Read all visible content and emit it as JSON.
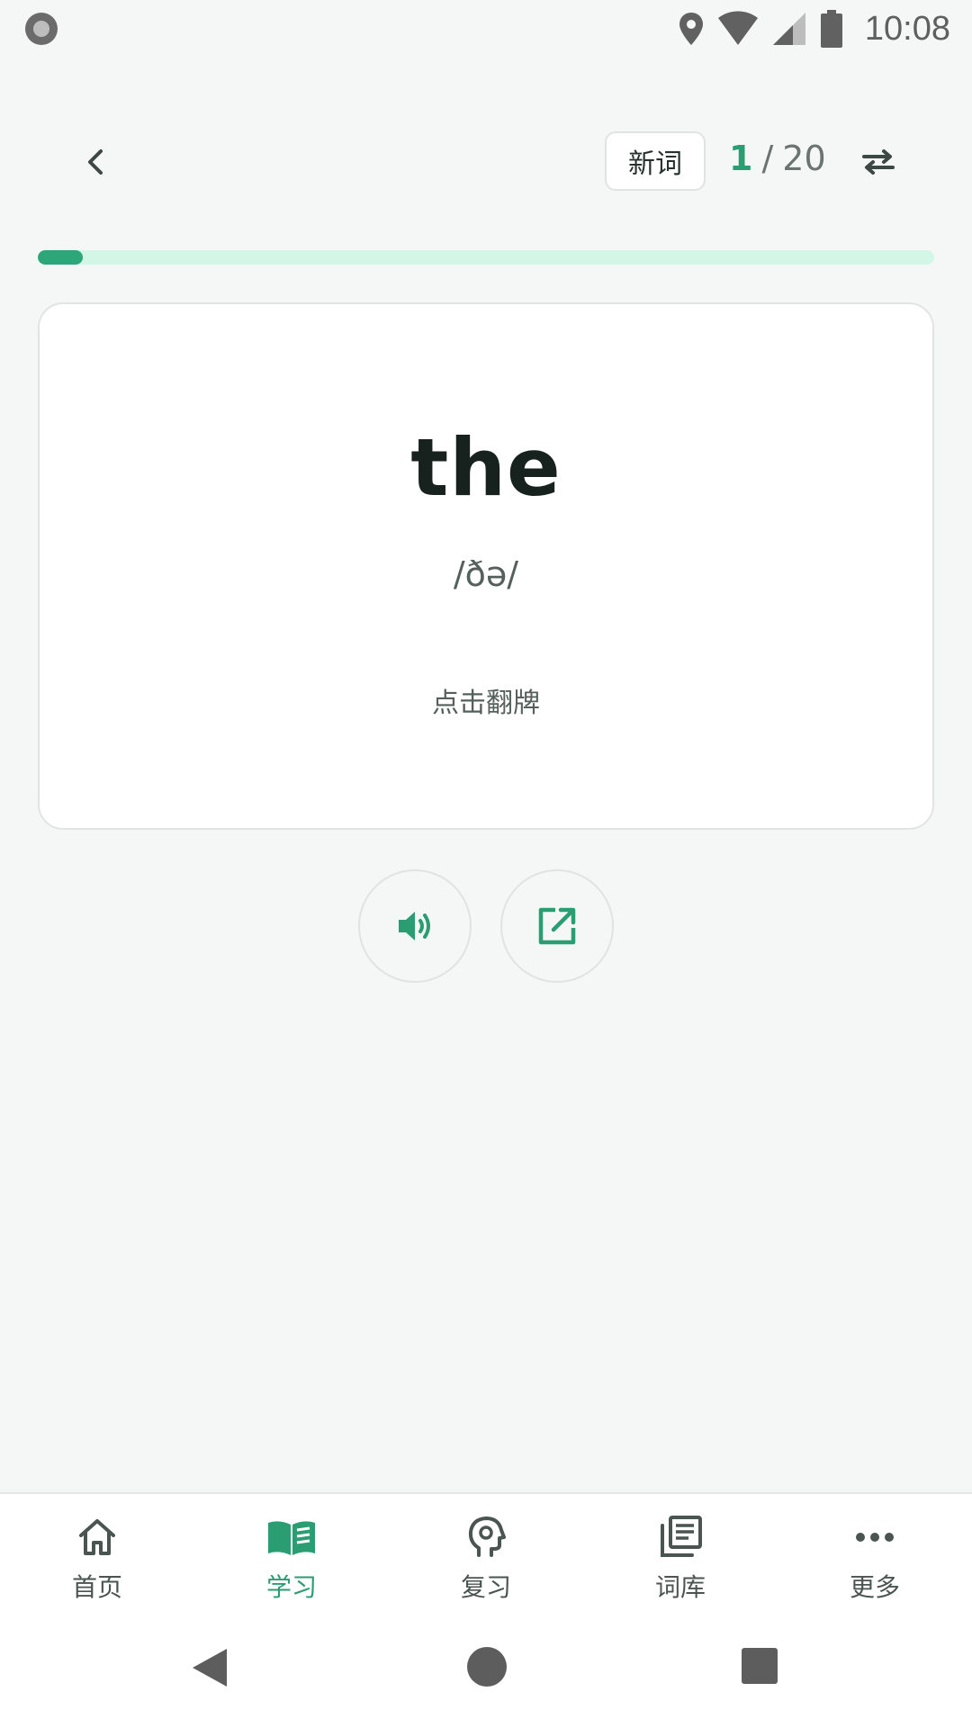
{
  "status_bar": {
    "time": "10:08",
    "icons": [
      "record-icon",
      "location-icon",
      "wifi-icon",
      "signal-icon",
      "battery-icon"
    ]
  },
  "header": {
    "mode_chip": "新词",
    "counter_current": "1",
    "counter_separator": "/",
    "counter_total": "20"
  },
  "progress": {
    "current": 1,
    "total": 20,
    "fraction": 0.05
  },
  "card": {
    "word": "the",
    "phonetic": "/ðə/",
    "hint": "点击翻牌"
  },
  "actions": [
    {
      "icon": "speaker-icon"
    },
    {
      "icon": "open-external-icon"
    }
  ],
  "bottom_nav": {
    "active": 1,
    "items": [
      {
        "label": "首页",
        "icon": "home-icon"
      },
      {
        "label": "学习",
        "icon": "book-icon"
      },
      {
        "label": "复习",
        "icon": "brain-head-icon"
      },
      {
        "label": "词库",
        "icon": "library-icon"
      },
      {
        "label": "更多",
        "icon": "more-dots-icon"
      }
    ]
  },
  "colors": {
    "accent": "#2a9d73",
    "progress_track": "#d3f7e6",
    "background": "#f5f7f6"
  }
}
